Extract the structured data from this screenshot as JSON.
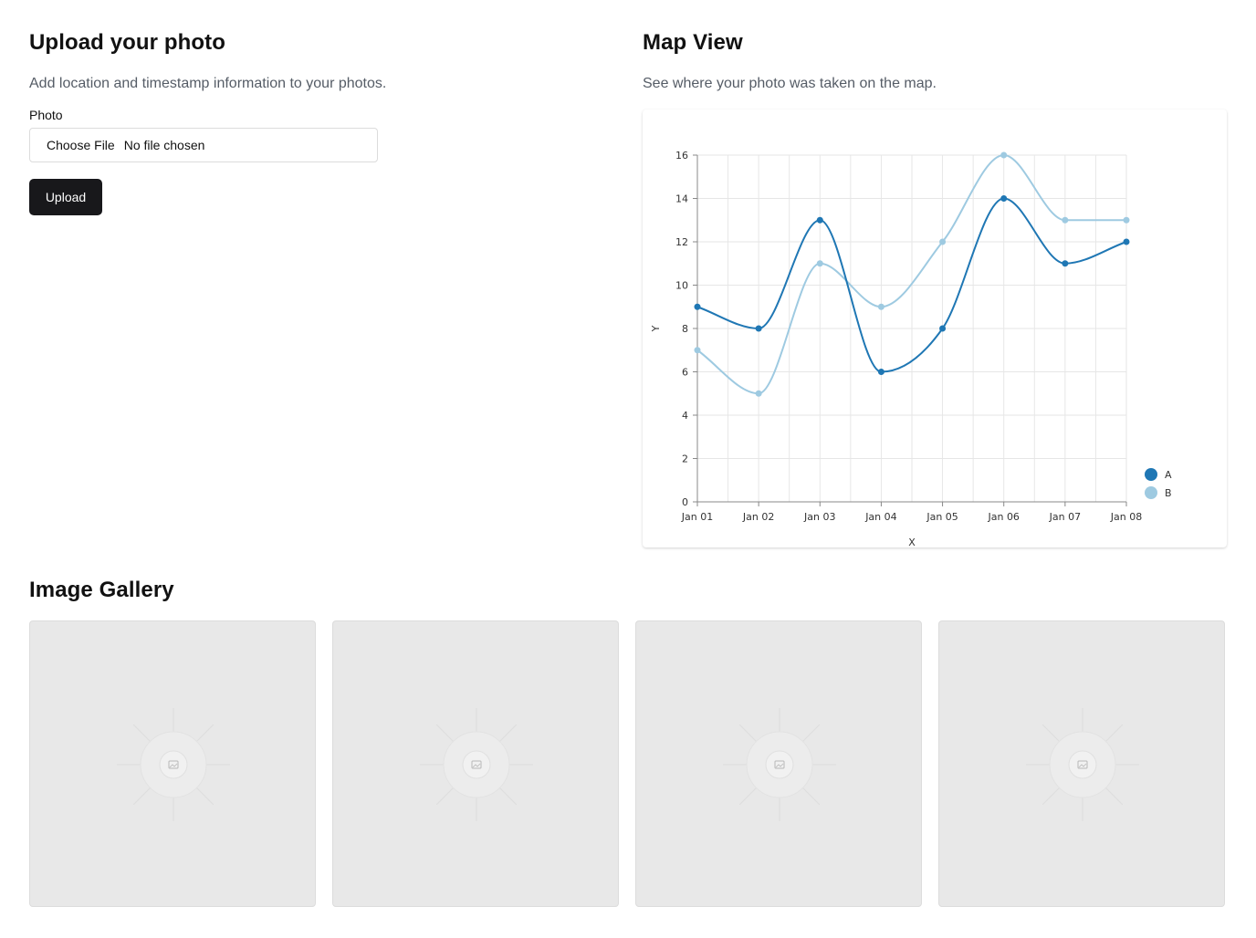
{
  "upload": {
    "title": "Upload your photo",
    "subtitle": "Add location and timestamp information to your photos.",
    "field_label": "Photo",
    "choose_file_label": "Choose File",
    "no_file_text": "No file chosen",
    "upload_button": "Upload"
  },
  "map": {
    "title": "Map View",
    "subtitle": "See where your photo was taken on the map."
  },
  "gallery": {
    "title": "Image Gallery",
    "items": [
      {
        "icon": "image-placeholder-icon"
      },
      {
        "icon": "image-placeholder-icon"
      },
      {
        "icon": "image-placeholder-icon"
      },
      {
        "icon": "image-placeholder-icon"
      }
    ]
  },
  "colors": {
    "series_a": "#1f77b4",
    "series_b": "#9ecae1",
    "button_bg": "#18181b",
    "tile_bg": "#e8e8e8"
  },
  "chart_data": {
    "type": "line",
    "title": "",
    "xlabel": "X",
    "ylabel": "Y",
    "categories": [
      "Jan 01",
      "Jan 02",
      "Jan 03",
      "Jan 04",
      "Jan 05",
      "Jan 06",
      "Jan 07",
      "Jan 08"
    ],
    "series": [
      {
        "name": "A",
        "values": [
          9,
          8,
          13,
          6,
          8,
          14,
          11,
          12
        ],
        "color": "#1f77b4"
      },
      {
        "name": "B",
        "values": [
          7,
          5,
          11,
          9,
          12,
          16,
          13,
          13
        ],
        "color": "#9ecae1"
      }
    ],
    "ylim": [
      0,
      16
    ],
    "yticks": [
      0,
      2,
      4,
      6,
      8,
      10,
      12,
      14,
      16
    ],
    "grid": true,
    "legend": "bottom-right",
    "curve": "smooth"
  }
}
